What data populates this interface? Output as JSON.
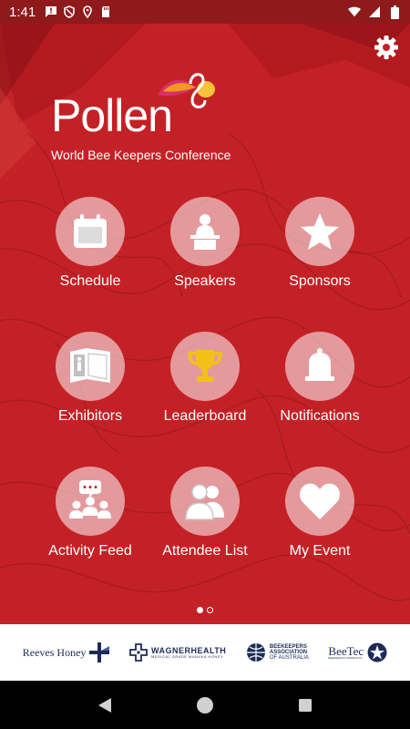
{
  "status_bar": {
    "time": "1:41",
    "left_icons": [
      "message-alert-icon",
      "shield-icon",
      "location-icon",
      "sd-card-icon"
    ],
    "right_icons": [
      "wifi-icon",
      "signal-icon",
      "battery-icon"
    ]
  },
  "header": {
    "settings_icon": "gear-icon"
  },
  "brand": {
    "name": "Pollen",
    "tagline": "World Bee Keepers Conference",
    "colors": {
      "primary_red": "#c42126",
      "mark_orange": "#f29a1f",
      "mark_yellow": "#f6c33b",
      "mark_pink": "#d9306b"
    }
  },
  "menu": {
    "items": [
      {
        "label": "Schedule",
        "icon": "calendar-icon"
      },
      {
        "label": "Speakers",
        "icon": "speaker-podium-icon"
      },
      {
        "label": "Sponsors",
        "icon": "star-icon"
      },
      {
        "label": "Exhibitors",
        "icon": "exhibitor-booth-icon"
      },
      {
        "label": "Leaderboard",
        "icon": "trophy-icon"
      },
      {
        "label": "Notifications",
        "icon": "bell-icon"
      },
      {
        "label": "Activity Feed",
        "icon": "chat-group-icon"
      },
      {
        "label": "Attendee List",
        "icon": "people-icon"
      },
      {
        "label": "My Event",
        "icon": "heart-icon"
      }
    ]
  },
  "pager": {
    "pages": 2,
    "current": 1
  },
  "sponsors": {
    "reeves": "Reeves Honey",
    "wagner": "WAGNERHEALTH",
    "wagner_sub": "MEDICAL GRADE MANUKA HONEY",
    "bee_assoc_1": "BEEKEEPERS",
    "bee_assoc_2": "ASSOCIATION",
    "bee_assoc_3": "OF AUSTRALIA",
    "beetec": "BeeTec",
    "beetec_sub": "BEEKEEPING PRODUCTS"
  },
  "nav_bar": {
    "icons": [
      "back-icon",
      "home-icon",
      "recents-icon"
    ]
  }
}
